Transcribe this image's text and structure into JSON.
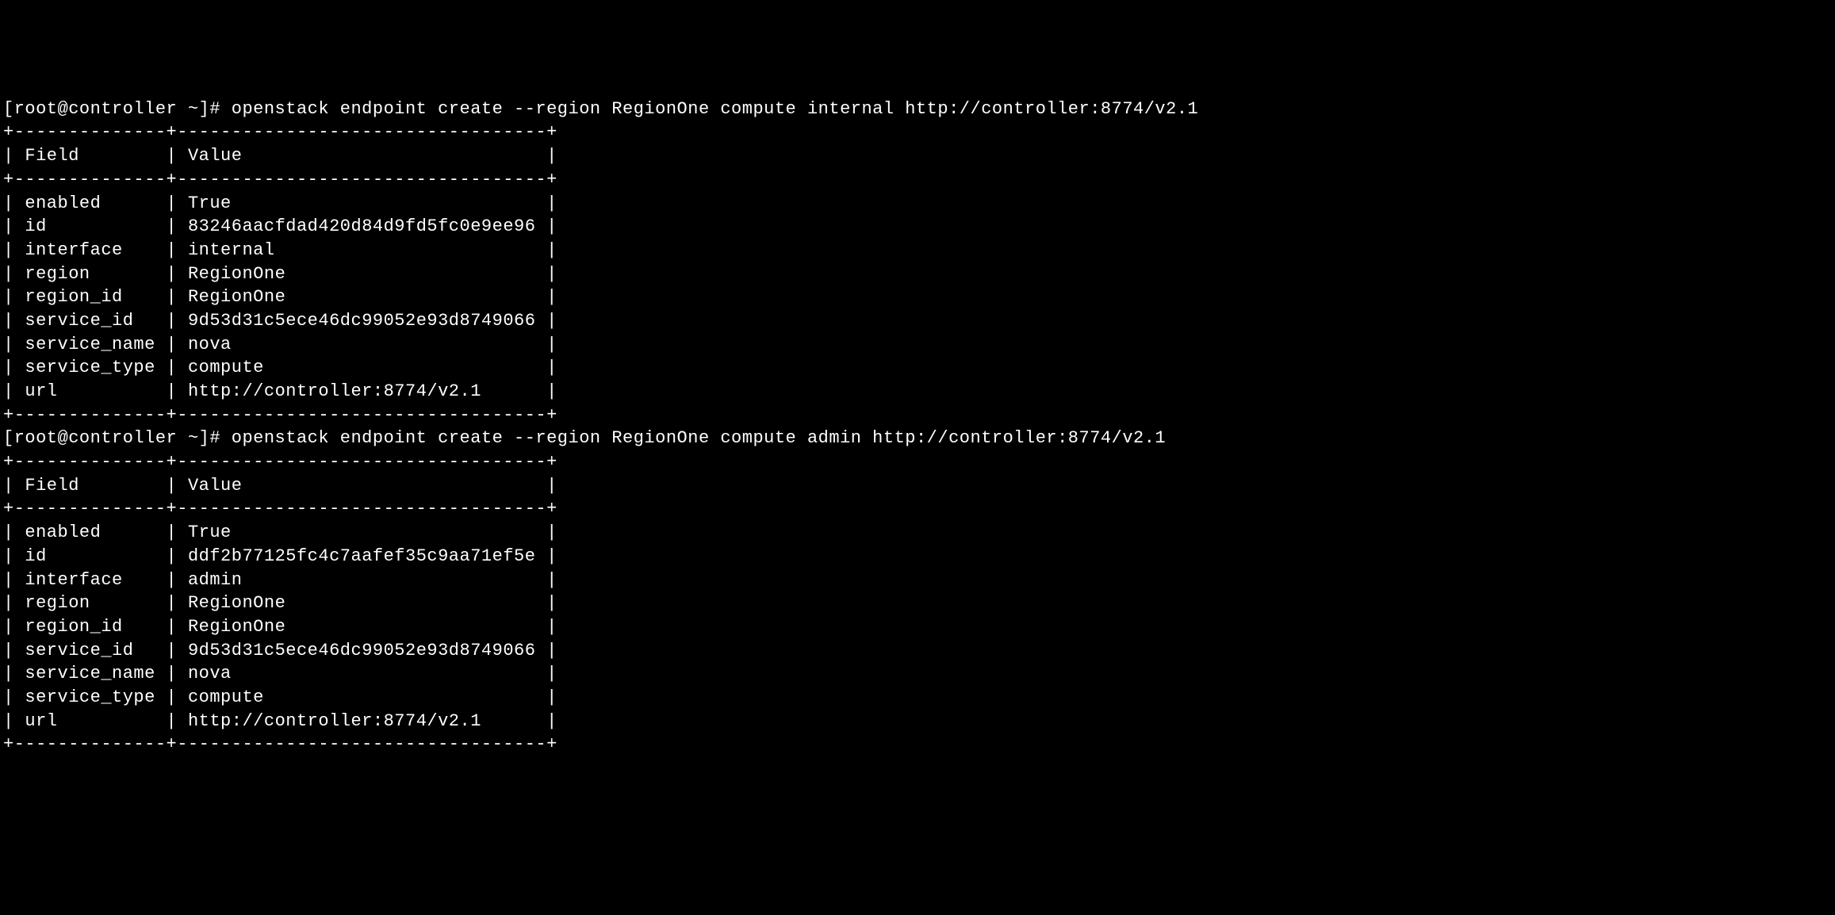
{
  "prompt1": "[root@controller ~]# openstack endpoint create --region RegionOne compute internal http://controller:8774/v2.1",
  "prompt2": "[root@controller ~]# openstack endpoint create --region RegionOne compute admin http://controller:8774/v2.1",
  "table_header_field": "Field",
  "table_header_value": "Value",
  "table1": {
    "rows": [
      {
        "field": "enabled",
        "value": "True"
      },
      {
        "field": "id",
        "value": "83246aacfdad420d84d9fd5fc0e9ee96"
      },
      {
        "field": "interface",
        "value": "internal"
      },
      {
        "field": "region",
        "value": "RegionOne"
      },
      {
        "field": "region_id",
        "value": "RegionOne"
      },
      {
        "field": "service_id",
        "value": "9d53d31c5ece46dc99052e93d8749066"
      },
      {
        "field": "service_name",
        "value": "nova"
      },
      {
        "field": "service_type",
        "value": "compute"
      },
      {
        "field": "url",
        "value": "http://controller:8774/v2.1"
      }
    ]
  },
  "table2": {
    "rows": [
      {
        "field": "enabled",
        "value": "True"
      },
      {
        "field": "id",
        "value": "ddf2b77125fc4c7aafef35c9aa71ef5e"
      },
      {
        "field": "interface",
        "value": "admin"
      },
      {
        "field": "region",
        "value": "RegionOne"
      },
      {
        "field": "region_id",
        "value": "RegionOne"
      },
      {
        "field": "service_id",
        "value": "9d53d31c5ece46dc99052e93d8749066"
      },
      {
        "field": "service_name",
        "value": "nova"
      },
      {
        "field": "service_type",
        "value": "compute"
      },
      {
        "field": "url",
        "value": "http://controller:8774/v2.1"
      }
    ]
  }
}
